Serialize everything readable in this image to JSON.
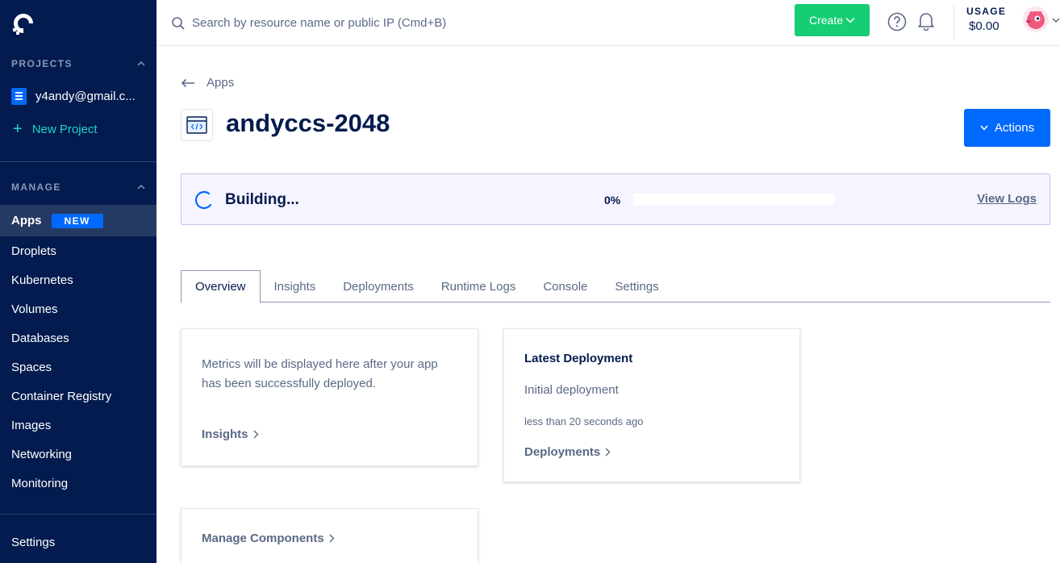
{
  "sidebar": {
    "projects_heading": "PROJECTS",
    "project_name": "y4andy@gmail.c...",
    "new_project_label": "New Project",
    "manage_heading": "MANAGE",
    "items": [
      {
        "label": "Apps",
        "badge": "NEW"
      },
      {
        "label": "Droplets"
      },
      {
        "label": "Kubernetes"
      },
      {
        "label": "Volumes"
      },
      {
        "label": "Databases"
      },
      {
        "label": "Spaces"
      },
      {
        "label": "Container Registry"
      },
      {
        "label": "Images"
      },
      {
        "label": "Networking"
      },
      {
        "label": "Monitoring"
      }
    ],
    "settings_label": "Settings"
  },
  "topbar": {
    "search_placeholder": "Search by resource name or public IP (Cmd+B)",
    "create_label": "Create",
    "usage_label": "USAGE",
    "usage_value": "$0.00"
  },
  "main": {
    "breadcrumb": "Apps",
    "app_name": "andyccs-2048",
    "actions_label": "Actions",
    "build": {
      "status": "Building...",
      "progress_text": "0%",
      "progress": 0,
      "view_logs_label": "View Logs"
    },
    "tabs": [
      {
        "label": "Overview"
      },
      {
        "label": "Insights"
      },
      {
        "label": "Deployments"
      },
      {
        "label": "Runtime Logs"
      },
      {
        "label": "Console"
      },
      {
        "label": "Settings"
      }
    ],
    "metrics_card": {
      "text": "Metrics will be displayed here after your app has been successfully deployed.",
      "link": "Insights"
    },
    "deployment_card": {
      "heading": "Latest Deployment",
      "name": "Initial deployment",
      "time": "less than 20 seconds ago",
      "link": "Deployments"
    },
    "components_card": {
      "link": "Manage Components"
    }
  },
  "colors": {
    "sidebar_bg": "#031b4e",
    "accent_blue": "#0069ff",
    "create_green": "#15cd72",
    "new_project_teal": "#21d4c4"
  }
}
